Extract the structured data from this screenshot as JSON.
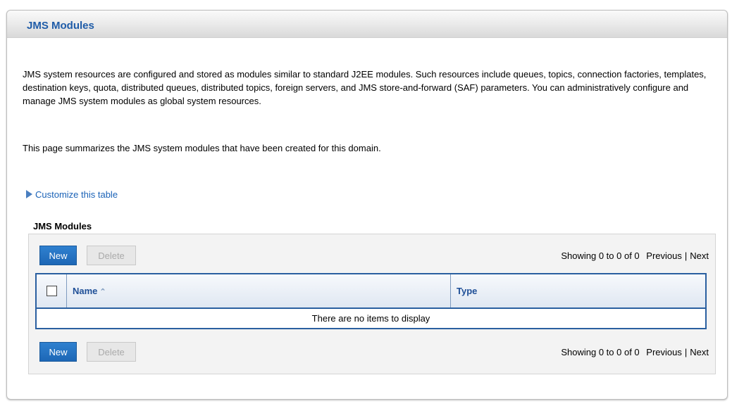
{
  "header": {
    "title": "JMS Modules"
  },
  "intro": {
    "paragraph": "JMS system resources are configured and stored as modules similar to standard J2EE modules. Such resources include queues, topics, connection factories, templates, destination keys, quota, distributed queues, distributed topics, foreign servers, and JMS store-and-forward (SAF) parameters. You can administratively configure and manage JMS system modules as global system resources.",
    "summary": "This page summarizes the JMS system modules that have been created for this domain."
  },
  "customize_link": "Customize this table",
  "table": {
    "caption": "JMS Modules",
    "new_label": "New",
    "delete_label": "Delete",
    "pager": {
      "showing": "Showing 0 to 0 of 0",
      "previous": "Previous",
      "next": "Next"
    },
    "columns": [
      "Name",
      "Type"
    ],
    "empty_message": "There are no items to display"
  },
  "colors": {
    "title": "#1f5ca8",
    "link": "#1a62b7",
    "primary_button": "#1d67b6",
    "grid_border": "#2a5fa0"
  },
  "icons": {
    "customize": "triangle-right-icon",
    "sort": "sort-ascending-icon"
  }
}
